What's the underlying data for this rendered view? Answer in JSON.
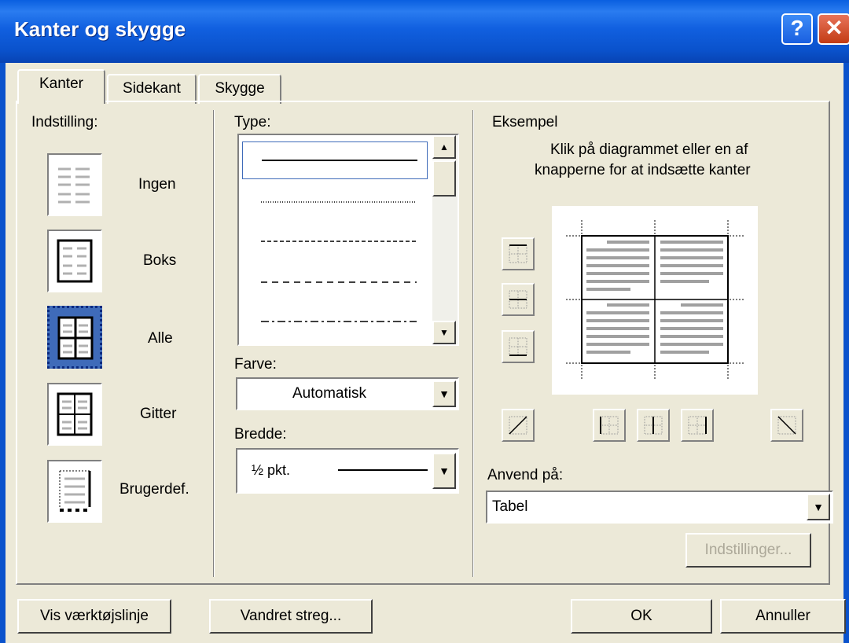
{
  "window": {
    "title": "Kanter og skygge"
  },
  "tabs": [
    {
      "label": "Kanter",
      "active": true
    },
    {
      "label": "Sidekant",
      "active": false
    },
    {
      "label": "Skygge",
      "active": false
    }
  ],
  "setting": {
    "heading": "Indstilling:",
    "items": [
      {
        "label": "Ingen",
        "icon": "setting-none-icon"
      },
      {
        "label": "Boks",
        "icon": "setting-box-icon"
      },
      {
        "label": "Alle",
        "icon": "setting-all-icon",
        "selected": true
      },
      {
        "label": "Gitter",
        "icon": "setting-grid-icon"
      },
      {
        "label": "Brugerdef.",
        "icon": "setting-custom-icon"
      }
    ]
  },
  "type": {
    "label": "Type:",
    "styles": [
      "solid",
      "dotted",
      "dashed-fine",
      "dashed",
      "dash-dot"
    ],
    "selected_index": 0
  },
  "color": {
    "label": "Farve:",
    "value": "Automatisk"
  },
  "width": {
    "label": "Bredde:",
    "value": "½ pkt."
  },
  "example": {
    "heading": "Eksempel",
    "hint_line1": "Klik på diagrammet eller en af",
    "hint_line2": "knapperne for at indsætte kanter"
  },
  "apply": {
    "label": "Anvend på:",
    "value": "Tabel"
  },
  "buttons": {
    "options": "Indstillinger...",
    "toolbar": "Vis værktøjslinje",
    "hline": "Vandret streg...",
    "ok": "OK",
    "cancel": "Annuller"
  },
  "colors": {
    "title_bar": "#0a52cc",
    "dialog_bg": "#ece9d8",
    "selection": "#3f6bb9"
  }
}
